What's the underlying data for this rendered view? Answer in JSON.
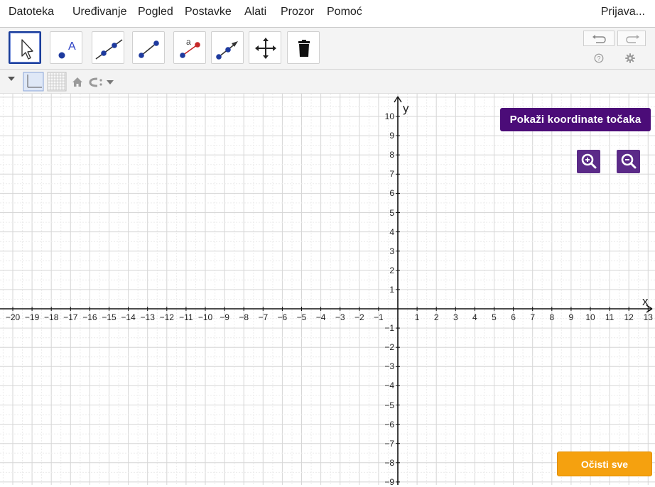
{
  "menubar": {
    "items": [
      "Datoteka",
      "Uređivanje",
      "Pogled",
      "Postavke",
      "Alati",
      "Prozor",
      "Pomoć"
    ],
    "signin": "Prijava..."
  },
  "toolbar": {
    "tools": [
      "move-tool",
      "point-tool",
      "line-tool",
      "segment-tool",
      "segment-with-label-tool",
      "vector-tool",
      "move-graphics-view-tool",
      "delete-tool"
    ],
    "selected": "move-tool"
  },
  "axes": {
    "x_label": "x",
    "y_label": "y",
    "x_ticks": [
      "−20",
      "−19",
      "−18",
      "−17",
      "−16",
      "−15",
      "−14",
      "−13",
      "−12",
      "−11",
      "−10",
      "−9",
      "−8",
      "−7",
      "−6",
      "−5",
      "−4",
      "−3",
      "−2",
      "−1",
      "1",
      "2",
      "3",
      "4",
      "5",
      "6",
      "7",
      "8",
      "9",
      "10",
      "11",
      "12",
      "13"
    ],
    "y_ticks_pos": [
      "10",
      "9",
      "8",
      "7",
      "6",
      "5",
      "4",
      "3",
      "2",
      "1"
    ],
    "y_ticks_neg": [
      "−1",
      "−2",
      "−3",
      "−4",
      "−5",
      "−6",
      "−7",
      "−8",
      "−9"
    ]
  },
  "buttons": {
    "show_coords": "Pokaži koordinate točaka",
    "clear_all": "Očisti sve"
  }
}
